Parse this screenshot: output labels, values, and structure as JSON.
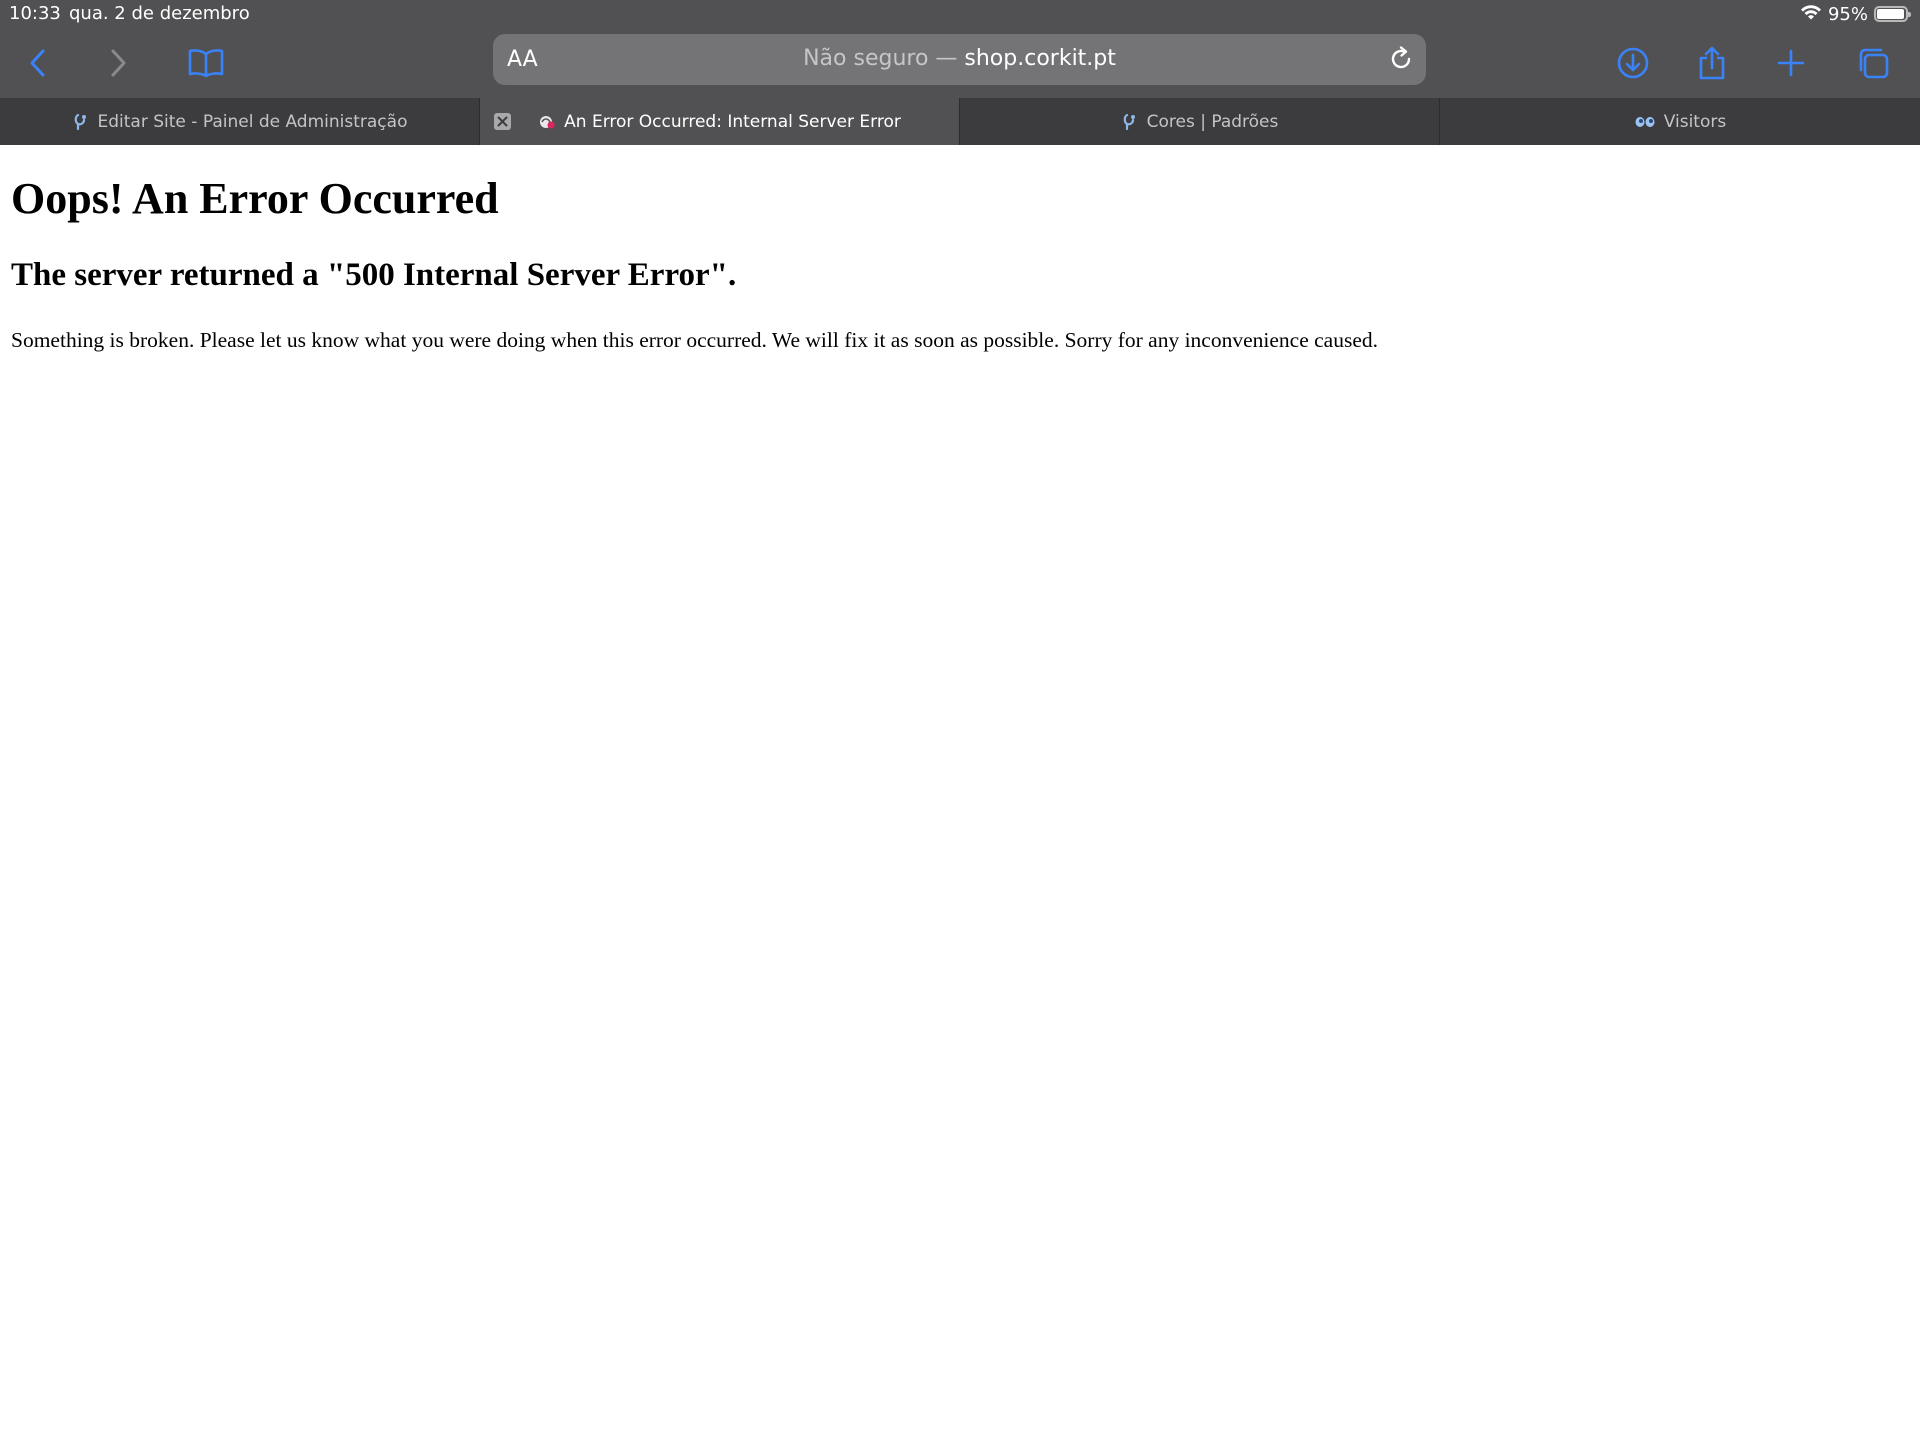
{
  "status_bar": {
    "time": "10:33",
    "date": "qua. 2 de dezembro",
    "battery_percent_label": "95%",
    "battery_level": 0.95,
    "wifi_icon": "wifi-icon",
    "battery_icon": "battery-icon"
  },
  "toolbar": {
    "icons": {
      "back": "chevron-left-icon",
      "forward": "chevron-right-icon",
      "bookmarks": "book-icon",
      "download": "download-icon",
      "share": "share-icon",
      "new_tab": "plus-icon",
      "tabs_overview": "tabs-icon",
      "reload": "reload-icon"
    },
    "text_size_label": "AA",
    "address": {
      "prefix": "Não seguro — ",
      "domain": "shop.corkit.pt"
    }
  },
  "tabs": [
    {
      "title": "Editar Site - Painel de Administração",
      "active": false,
      "favicon": "site-editor-favicon"
    },
    {
      "title": "An Error Occurred: Internal Server Error",
      "active": true,
      "favicon": "error-favicon"
    },
    {
      "title": "Cores | Padrões",
      "active": false,
      "favicon": "site-editor-favicon"
    },
    {
      "title": "Visitors",
      "active": false,
      "favicon": "visitors-favicon"
    }
  ],
  "content": {
    "heading": "Oops! An Error Occurred",
    "subheading": "The server returned a \"500 Internal Server Error\".",
    "message": "Something is broken. Please let us know what you were doing when this error occurred. We will fix it as soon as possible. Sorry for any inconvenience caused."
  },
  "colors": {
    "chrome_background": "#515153",
    "address_field": "#747476",
    "inactive_tab": "#3c3c3e",
    "accent": "#3a82f7",
    "page_background": "#ffffff",
    "text": "#000000"
  }
}
